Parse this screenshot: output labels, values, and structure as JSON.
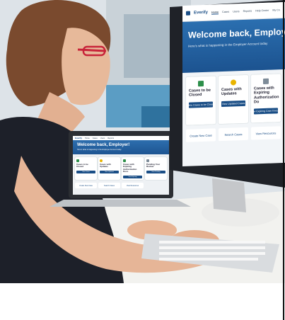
{
  "monitor": {
    "logo": "Everify",
    "nav": [
      "Home",
      "Cases",
      "Users",
      "Reports",
      "Help Center",
      "My Co"
    ],
    "welcome": "Welcome back, Employer Agent!",
    "subtitle": "Here's what is happening in the Employer Account today",
    "cards": [
      {
        "icon": "folder-icon",
        "title": "Cases to be Closed",
        "button": "View Cases to be Closed"
      },
      {
        "icon": "bell-icon",
        "title": "Cases with Updates",
        "button": "View Updated Cases"
      },
      {
        "icon": "hourglass-icon",
        "title": "Cases with Expiring Authorization Do",
        "button": "View Expiring Case Docume"
      }
    ],
    "actions": [
      "Create New Case",
      "Search Cases",
      "View Resources"
    ]
  },
  "laptop": {
    "logo": "Everify",
    "nav": [
      "Home",
      "Cases",
      "Users",
      "Reports"
    ],
    "welcome": "Welcome back, Employer!",
    "subtitle": "Here's what is happening in the Employer Account today",
    "cards": [
      {
        "title": "Cases to be Closed",
        "button": "View Cases"
      },
      {
        "title": "Cases with Updates",
        "button": "View Updated"
      },
      {
        "title": "Cases with Expiring Authorization Docs",
        "button": "View Expiring"
      },
      {
        "title": "Pending Your Review",
        "button": "View Pending"
      }
    ],
    "actions": [
      "Create New Case",
      "Search Cases",
      "View Resources"
    ]
  },
  "colors": {
    "brand_blue": "#1a4e86",
    "hero_blue": "#2b6fb0",
    "accent_green": "#2d8f4a",
    "accent_yellow": "#e9b400"
  }
}
